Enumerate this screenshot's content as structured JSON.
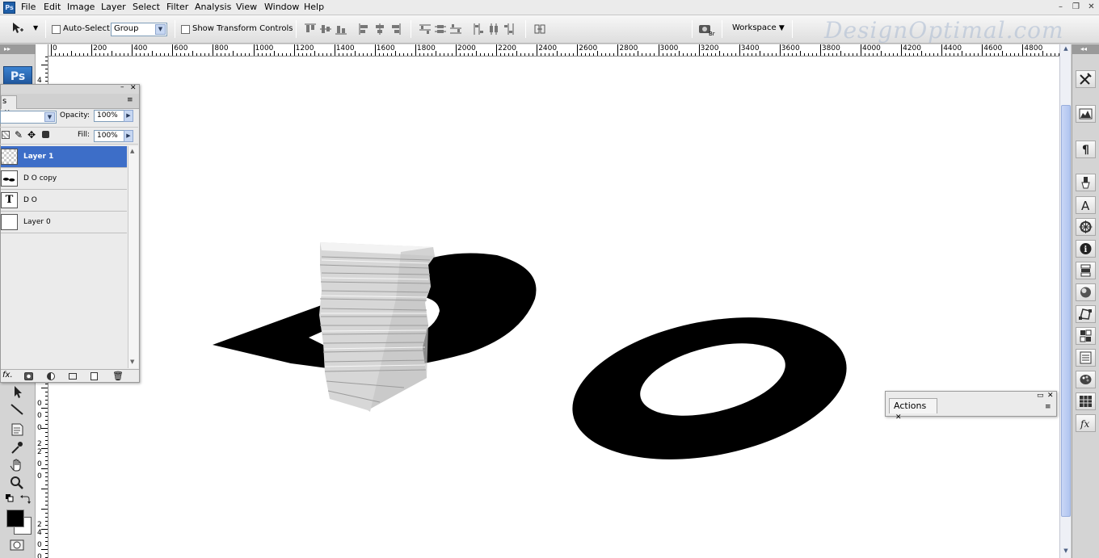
{
  "app": {
    "badge": "Ps",
    "logo": "Ps"
  },
  "menu": [
    {
      "label": "File"
    },
    {
      "label": "Edit"
    },
    {
      "label": "Image"
    },
    {
      "label": "Layer"
    },
    {
      "label": "Select"
    },
    {
      "label": "Filter"
    },
    {
      "label": "Analysis"
    },
    {
      "label": "View"
    },
    {
      "label": "Window"
    },
    {
      "label": "Help"
    }
  ],
  "window_controls": {
    "minimize": "–",
    "restore": "❐",
    "close": "✕"
  },
  "options": {
    "auto_select_label": "Auto-Select:",
    "auto_select_value": "Group",
    "show_transform_label": "Show Transform Controls",
    "workspace_label": "Workspace",
    "bridge_label": "Br"
  },
  "watermark": "DesignOptimal.com",
  "toolbar_header": "▸▸",
  "ruler": {
    "top_labels": [
      "0",
      "200",
      "400",
      "600",
      "800",
      "1000",
      "1200",
      "1400",
      "1600",
      "1800",
      "2000",
      "2200",
      "2400",
      "2600",
      "2800",
      "3000",
      "3200",
      "3400",
      "3600",
      "3800",
      "4000",
      "4200",
      "4400",
      "4600",
      "4800"
    ],
    "left_labels": [
      "4",
      "2",
      "0",
      "0",
      "0",
      "2",
      "2",
      "0",
      "0",
      "2",
      "4",
      "0",
      "0"
    ]
  },
  "layers_panel": {
    "tab_label": "s",
    "opacity_label": "Opacity:",
    "opacity_value": "100%",
    "fill_label": "Fill:",
    "fill_value": "100%",
    "layers": [
      {
        "name": "Layer 1",
        "selected": true,
        "thumb": "checker"
      },
      {
        "name": "D O copy",
        "selected": false,
        "thumb": "text-art"
      },
      {
        "name": "D O",
        "selected": false,
        "thumb": "T"
      },
      {
        "name": "Layer 0",
        "selected": false,
        "thumb": "white"
      }
    ],
    "footer_fx": "fx."
  },
  "actions_panel": {
    "tab_label": "Actions"
  },
  "dock_icons": [
    "tools-icon",
    "histogram-icon",
    "paragraph-icon",
    "clone-source-icon",
    "character-icon",
    "navigator-icon",
    "info-icon",
    "layer-comps-icon",
    "color-icon",
    "paths-icon",
    "channels-icon",
    "history-icon",
    "swatches-icon",
    "grid-icon",
    "fx-icon"
  ],
  "colors": {
    "selection": "#3d6ec8",
    "foreground": "#000000",
    "background": "#ffffff",
    "scroll_thumb": "#b0c4ef"
  }
}
